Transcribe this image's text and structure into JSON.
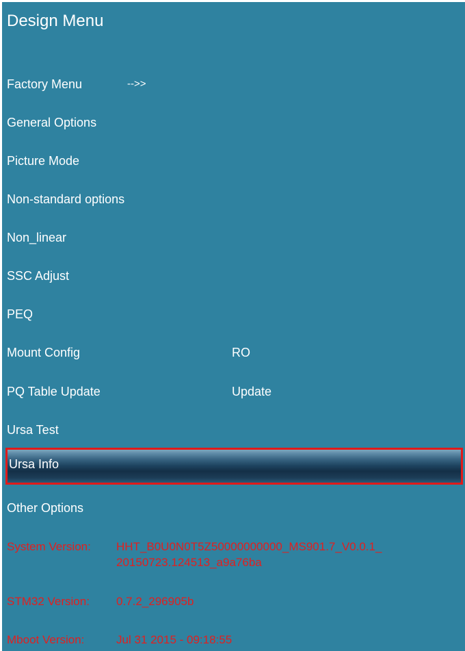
{
  "title": "Design Menu",
  "menu": {
    "factory": {
      "label": "Factory Menu",
      "arrow": "-->>"
    },
    "general": {
      "label": "General Options"
    },
    "picture": {
      "label": "Picture Mode"
    },
    "nonstandard": {
      "label": "Non-standard options"
    },
    "nonlinear": {
      "label": "Non_linear"
    },
    "ssc": {
      "label": "SSC Adjust"
    },
    "peq": {
      "label": "PEQ"
    },
    "mount": {
      "label": "Mount Config",
      "value": "RO"
    },
    "pqtable": {
      "label": "PQ Table Update",
      "value": "Update"
    },
    "ursatest": {
      "label": "Ursa Test"
    },
    "ursainfo": {
      "label": "Ursa Info"
    },
    "other": {
      "label": "Other Options"
    }
  },
  "info": {
    "system": {
      "label": "System Version:",
      "line1": "HHT_B0U0N0T5Z50000000000_MS901.7_V0.0.1_",
      "line2": "20150723.124513_a9a76ba"
    },
    "stm32": {
      "label": "STM32 Version:",
      "value": "0.7.2_296905b"
    },
    "mboot": {
      "label": "Mboot Version:",
      "value": "Jul 31 2015 - 09:18:55"
    }
  },
  "colors": {
    "background": "#2f82a0",
    "text": "#ffffff",
    "info_text": "#e02020",
    "selection_border": "#e01a1a"
  }
}
